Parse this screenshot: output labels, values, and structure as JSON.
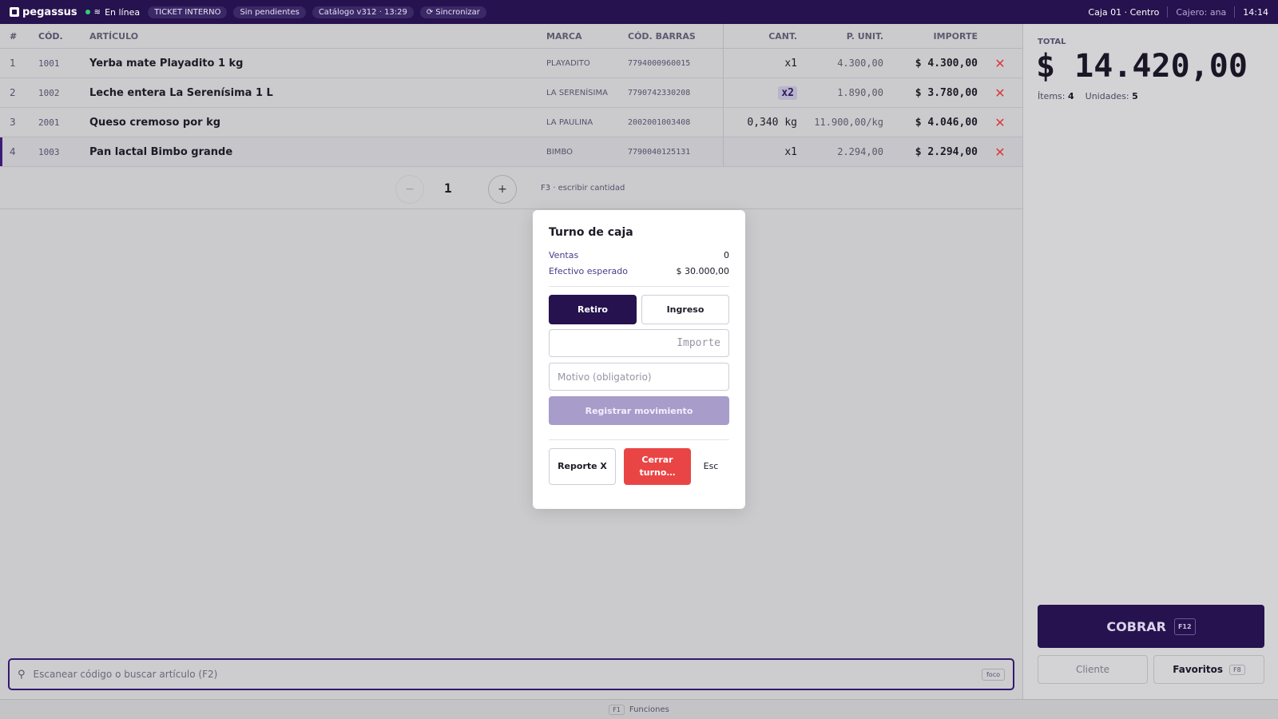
{
  "topbar": {
    "brand": "pegassus",
    "status": "En línea",
    "pills": [
      "TICKET INTERNO",
      "Sin pendientes",
      "Catálogo v312 · 13:29"
    ],
    "sync_label": "Sincronizar",
    "register": "Caja 01 · Centro",
    "cashier_label": "Cajero:",
    "cashier_name": "ana",
    "time": "14:14"
  },
  "table": {
    "headers": {
      "num": "#",
      "cod": "CÓD.",
      "articulo": "ARTÍCULO",
      "marca": "MARCA",
      "barras": "CÓD. BARRAS",
      "cant": "CANT.",
      "punit": "P. UNIT.",
      "importe": "IMPORTE"
    },
    "rows": [
      {
        "num": "1",
        "cod": "1001",
        "articulo": "Yerba mate Playadito 1 kg",
        "marca": "PLAYADITO",
        "barras": "7794000960015",
        "cant": "x1",
        "punit": "4.300,00",
        "importe": "$ 4.300,00"
      },
      {
        "num": "2",
        "cod": "1002",
        "articulo": "Leche entera La Serenísima 1 L",
        "marca": "LA SERENÍSIMA",
        "barras": "7790742330208",
        "cant": "x2",
        "punit": "1.890,00",
        "importe": "$ 3.780,00"
      },
      {
        "num": "3",
        "cod": "2001",
        "articulo": "Queso cremoso por kg",
        "marca": "LA PAULINA",
        "barras": "2002001003408",
        "cant": "0,340 kg",
        "punit": "11.900,00/kg",
        "importe": "$ 4.046,00"
      },
      {
        "num": "4",
        "cod": "1003",
        "articulo": "Pan lactal Bimbo grande",
        "marca": "BIMBO",
        "barras": "7790040125131",
        "cant": "x1",
        "punit": "2.294,00",
        "importe": "$ 2.294,00"
      }
    ],
    "delete_glyph": "✕"
  },
  "quantity": {
    "minus": "−",
    "value": "1",
    "plus": "+",
    "hint": "F3 · escribir cantidad"
  },
  "search": {
    "placeholder": "Escanear código o buscar artículo (F2)",
    "focus_key": "foco"
  },
  "footer": {
    "key": "F1",
    "label": "Funciones"
  },
  "summary": {
    "total_label": "TOTAL",
    "total_value": "$ 14.420,00",
    "items_label": "Ítems:",
    "items_value": "4",
    "units_label": "Unidades:",
    "units_value": "5"
  },
  "actions": {
    "cobrar": "COBRAR",
    "cobrar_key": "F12",
    "cliente": "Cliente",
    "favoritos": "Favoritos",
    "favoritos_key": "F8"
  },
  "modal": {
    "title": "Turno de caja",
    "ventas_label": "Ventas",
    "ventas_value": "0",
    "efectivo_label": "Efectivo esperado",
    "efectivo_value": "$ 30.000,00",
    "retiro": "Retiro",
    "ingreso": "Ingreso",
    "importe_placeholder": "Importe",
    "motivo_placeholder": "Motivo (obligatorio)",
    "registrar": "Registrar movimiento",
    "reporte": "Reporte X",
    "cerrar": "Cerrar turno…",
    "esc": "Esc"
  },
  "colors": {
    "brand": "#26124e",
    "danger": "#ea4545",
    "online": "#2fd07a"
  }
}
